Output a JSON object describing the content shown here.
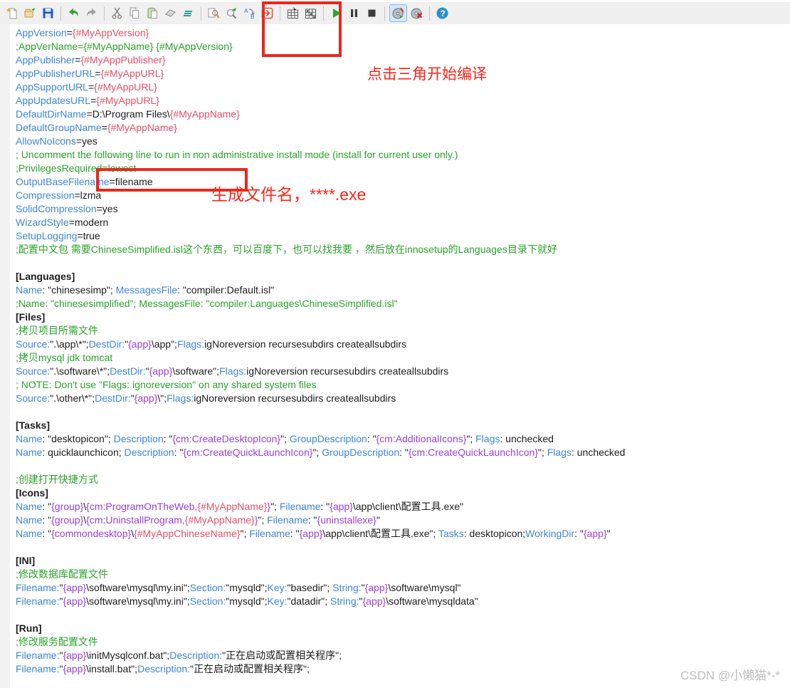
{
  "toolbar": {
    "buttons": [
      {
        "name": "new-script",
        "icon": "new-file"
      },
      {
        "name": "open-script",
        "icon": "open-file"
      },
      {
        "name": "save-script",
        "icon": "save"
      },
      {
        "sep": true
      },
      {
        "name": "undo",
        "icon": "undo"
      },
      {
        "name": "redo",
        "icon": "redo"
      },
      {
        "sep": true
      },
      {
        "name": "cut",
        "icon": "cut"
      },
      {
        "name": "copy",
        "icon": "copy"
      },
      {
        "name": "paste",
        "icon": "paste"
      },
      {
        "name": "delete",
        "icon": "eraser"
      },
      {
        "name": "select-all",
        "icon": "lines"
      },
      {
        "sep": true
      },
      {
        "name": "find",
        "icon": "find"
      },
      {
        "name": "find-next",
        "icon": "find-next"
      },
      {
        "name": "replace",
        "icon": "replace"
      },
      {
        "name": "goto-line",
        "icon": "goto"
      },
      {
        "sep": true
      },
      {
        "name": "compile",
        "icon": "compile"
      },
      {
        "name": "stop-compile",
        "icon": "compile-stop"
      },
      {
        "sep": true
      },
      {
        "name": "run",
        "icon": "run"
      },
      {
        "name": "pause",
        "icon": "pause"
      },
      {
        "name": "terminate",
        "icon": "stop"
      },
      {
        "sep": true
      },
      {
        "name": "target-setup",
        "icon": "disc",
        "highlighted": true
      },
      {
        "name": "target-uninstall",
        "icon": "disc-x"
      },
      {
        "sep": true
      },
      {
        "name": "help",
        "icon": "help"
      }
    ]
  },
  "colors": {
    "keyword": "#3e86d4",
    "comment": "#2ba32b",
    "define": "#e3506b",
    "constant": "#9a3fd6",
    "text": "#1c1c1c",
    "annotation": "#fa251a",
    "toolbar_bg": "#f0f0f0"
  },
  "annotations": {
    "compile_note": "点击三角开始编译",
    "filename_note": "生成文件名，****.exe"
  },
  "watermark": "CSDN @小懒猫*-*",
  "editor": {
    "lines": [
      [
        [
          "k",
          "AppVersion"
        ],
        [
          "v",
          "="
        ],
        [
          "r",
          "{#MyAppVersion}"
        ]
      ],
      [
        [
          "c",
          ";AppVerName={#MyAppName} {#MyAppVersion}"
        ]
      ],
      [
        [
          "k",
          "AppPublisher"
        ],
        [
          "v",
          "="
        ],
        [
          "r",
          "{#MyAppPublisher}"
        ]
      ],
      [
        [
          "k",
          "AppPublisherURL"
        ],
        [
          "v",
          "="
        ],
        [
          "r",
          "{#MyAppURL}"
        ]
      ],
      [
        [
          "k",
          "AppSupportURL"
        ],
        [
          "v",
          "="
        ],
        [
          "r",
          "{#MyAppURL}"
        ]
      ],
      [
        [
          "k",
          "AppUpdatesURL"
        ],
        [
          "v",
          "="
        ],
        [
          "r",
          "{#MyAppURL}"
        ]
      ],
      [
        [
          "k",
          "DefaultDirName"
        ],
        [
          "v",
          "=D:\\Program Files\\"
        ],
        [
          "r",
          "{#MyAppName}"
        ]
      ],
      [
        [
          "k",
          "DefaultGroupName"
        ],
        [
          "v",
          "="
        ],
        [
          "r",
          "{#MyAppName}"
        ]
      ],
      [
        [
          "k",
          "AllowNoIcons"
        ],
        [
          "v",
          "=yes"
        ]
      ],
      [
        [
          "c",
          "; Uncomment the following line to run in non administrative install mode (install for current user only.)"
        ]
      ],
      [
        [
          "c",
          ";PrivilegesRequired=lowest"
        ]
      ],
      [
        [
          "k",
          "OutputBaseFilename"
        ],
        [
          "v",
          "=filename"
        ]
      ],
      [
        [
          "k",
          "Compression"
        ],
        [
          "v",
          "=lzma"
        ]
      ],
      [
        [
          "k",
          "SolidCompression"
        ],
        [
          "v",
          "=yes"
        ]
      ],
      [
        [
          "k",
          "WizardStyle"
        ],
        [
          "v",
          "=modern"
        ]
      ],
      [
        [
          "k",
          "SetupLogging"
        ],
        [
          "v",
          "=true"
        ]
      ],
      [
        [
          "c",
          ";配置中文包 需要ChineseSimplified.isl这个东西，可以百度下，也可以找我要 ，然后放在innosetup的Languages目录下就好"
        ]
      ],
      [],
      [
        [
          "s",
          "[Languages]"
        ]
      ],
      [
        [
          "k",
          "Name"
        ],
        [
          "v",
          ": \"chinesesimp\"; "
        ],
        [
          "k",
          "MessagesFile"
        ],
        [
          "v",
          ": \"compiler:Default.isl\""
        ]
      ],
      [
        [
          "c",
          ";Name: \"chinesesimplified\"; MessagesFile: \"compiler:Languages\\ChineseSimplified.isl\""
        ]
      ],
      [
        [
          "s",
          "[Files]"
        ]
      ],
      [
        [
          "c",
          ";拷贝项目所需文件"
        ]
      ],
      [
        [
          "k",
          "Source:"
        ],
        [
          "v",
          "\".\\app\\*\";"
        ],
        [
          "k",
          "DestDir:"
        ],
        [
          "v",
          "\""
        ],
        [
          "p",
          "{app}"
        ],
        [
          "v",
          "\\app\";"
        ],
        [
          "k",
          "Flags:"
        ],
        [
          "v",
          "igNoreversion recursesubdirs createallsubdirs"
        ]
      ],
      [
        [
          "c",
          ";拷贝mysql jdk tomcat"
        ]
      ],
      [
        [
          "k",
          "Source:"
        ],
        [
          "v",
          "\".\\software\\*\";"
        ],
        [
          "k",
          "DestDir:"
        ],
        [
          "v",
          "\""
        ],
        [
          "p",
          "{app}"
        ],
        [
          "v",
          "\\software\";"
        ],
        [
          "k",
          "Flags:"
        ],
        [
          "v",
          "igNoreversion recursesubdirs createallsubdirs"
        ]
      ],
      [
        [
          "c",
          "; NOTE: Don't use \"Flags: ignoreversion\" on any shared system files"
        ]
      ],
      [
        [
          "k",
          "Source:"
        ],
        [
          "v",
          "\".\\other\\*\";"
        ],
        [
          "k",
          "DestDir:"
        ],
        [
          "v",
          "\""
        ],
        [
          "p",
          "{app}"
        ],
        [
          "v",
          "\\\";"
        ],
        [
          "k",
          "Flags:"
        ],
        [
          "v",
          "igNoreversion recursesubdirs createallsubdirs"
        ]
      ],
      [],
      [
        [
          "s",
          "[Tasks]"
        ]
      ],
      [
        [
          "k",
          "Name"
        ],
        [
          "v",
          ": \"desktopicon\"; "
        ],
        [
          "k",
          "Description"
        ],
        [
          "v",
          ": \""
        ],
        [
          "p",
          "{cm:CreateDesktopIcon}"
        ],
        [
          "v",
          "\"; "
        ],
        [
          "k",
          "GroupDescription"
        ],
        [
          "v",
          ": \""
        ],
        [
          "p",
          "{cm:AdditionalIcons}"
        ],
        [
          "v",
          "\"; "
        ],
        [
          "k",
          "Flags"
        ],
        [
          "v",
          ": unchecked"
        ]
      ],
      [
        [
          "k",
          "Name"
        ],
        [
          "v",
          ": quicklaunchicon; "
        ],
        [
          "k",
          "Description"
        ],
        [
          "v",
          ": \""
        ],
        [
          "p",
          "{cm:CreateQuickLaunchIcon}"
        ],
        [
          "v",
          "\"; "
        ],
        [
          "k",
          "GroupDescription"
        ],
        [
          "v",
          ": \""
        ],
        [
          "p",
          "{cm:CreateQuickLaunchIcon}"
        ],
        [
          "v",
          "\"; "
        ],
        [
          "k",
          "Flags"
        ],
        [
          "v",
          ": unchecked"
        ]
      ],
      [],
      [
        [
          "c",
          ";创建打开快捷方式"
        ]
      ],
      [
        [
          "s",
          "[Icons]"
        ]
      ],
      [
        [
          "k",
          "Name"
        ],
        [
          "v",
          ": \""
        ],
        [
          "p",
          "{group}"
        ],
        [
          "v",
          "\\"
        ],
        [
          "p",
          "{cm:ProgramOnTheWeb,"
        ],
        [
          "r",
          "{#MyAppName}"
        ],
        [
          "p",
          "}"
        ],
        [
          "v",
          "\"; "
        ],
        [
          "k",
          "Filename"
        ],
        [
          "v",
          ": \""
        ],
        [
          "p",
          "{app}"
        ],
        [
          "v",
          "\\app\\client\\配置工具.exe\""
        ]
      ],
      [
        [
          "k",
          "Name"
        ],
        [
          "v",
          ": \""
        ],
        [
          "p",
          "{group}"
        ],
        [
          "v",
          "\\"
        ],
        [
          "p",
          "{cm:UninstallProgram,"
        ],
        [
          "r",
          "{#MyAppName}"
        ],
        [
          "p",
          "}"
        ],
        [
          "v",
          "\"; "
        ],
        [
          "k",
          "Filename"
        ],
        [
          "v",
          ": \""
        ],
        [
          "p",
          "{uninstallexe}"
        ],
        [
          "v",
          "\""
        ]
      ],
      [
        [
          "k",
          "Name"
        ],
        [
          "v",
          ": \""
        ],
        [
          "p",
          "{commondesktop}"
        ],
        [
          "v",
          "\\"
        ],
        [
          "r",
          "{#MyAppChineseName}"
        ],
        [
          "v",
          "\"; "
        ],
        [
          "k",
          "Filename"
        ],
        [
          "v",
          ": \""
        ],
        [
          "p",
          "{app}"
        ],
        [
          "v",
          "\\app\\client\\配置工具.exe\"; "
        ],
        [
          "k",
          "Tasks"
        ],
        [
          "v",
          ": desktopicon;"
        ],
        [
          "k",
          "WorkingDir"
        ],
        [
          "v",
          ": \""
        ],
        [
          "p",
          "{app}"
        ],
        [
          "v",
          "\""
        ]
      ],
      [],
      [
        [
          "s",
          "[INI]"
        ]
      ],
      [
        [
          "c",
          ";修改数据库配置文件"
        ]
      ],
      [
        [
          "k",
          "Filename:"
        ],
        [
          "v",
          "\""
        ],
        [
          "p",
          "{app}"
        ],
        [
          "v",
          "\\software\\mysql\\my.ini\";"
        ],
        [
          "k",
          "Section:"
        ],
        [
          "v",
          "\"mysqld\";"
        ],
        [
          "k",
          "Key:"
        ],
        [
          "v",
          "\"basedir\"; "
        ],
        [
          "k",
          "String:"
        ],
        [
          "v",
          "\""
        ],
        [
          "p",
          "{app}"
        ],
        [
          "v",
          "\\software\\mysql\""
        ]
      ],
      [
        [
          "k",
          "Filename:"
        ],
        [
          "v",
          "\""
        ],
        [
          "p",
          "{app}"
        ],
        [
          "v",
          "\\software\\mysql\\my.ini\";"
        ],
        [
          "k",
          "Section:"
        ],
        [
          "v",
          "\"mysqld\";"
        ],
        [
          "k",
          "Key:"
        ],
        [
          "v",
          "\"datadir\"; "
        ],
        [
          "k",
          "String:"
        ],
        [
          "v",
          "\""
        ],
        [
          "p",
          "{app}"
        ],
        [
          "v",
          "\\software\\mysqldata\""
        ]
      ],
      [],
      [
        [
          "s",
          "[Run]"
        ]
      ],
      [
        [
          "c",
          ";修改服务配置文件"
        ]
      ],
      [
        [
          "k",
          "Filename:"
        ],
        [
          "v",
          "\""
        ],
        [
          "p",
          "{app}"
        ],
        [
          "v",
          "\\initMysqlconf.bat\";"
        ],
        [
          "k",
          "Description:"
        ],
        [
          "v",
          "\"正在启动或配置相关程序\";"
        ]
      ],
      [
        [
          "k",
          "Filename:"
        ],
        [
          "v",
          "\""
        ],
        [
          "p",
          "{app}"
        ],
        [
          "v",
          "\\install.bat\";"
        ],
        [
          "k",
          "Description:"
        ],
        [
          "v",
          "\"正在启动或配置相关程序\";"
        ]
      ]
    ]
  }
}
